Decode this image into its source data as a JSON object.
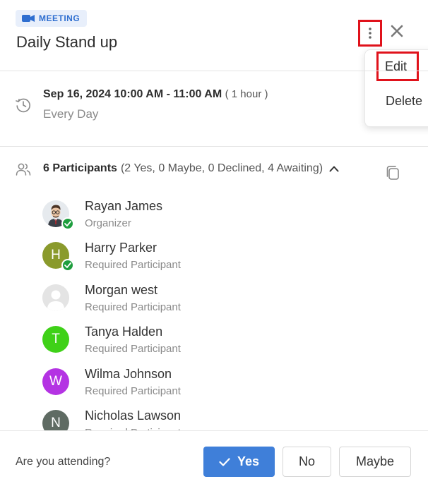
{
  "header": {
    "badge_label": "MEETING",
    "badge_icon": "video-camera-icon",
    "title": "Daily Stand up",
    "more_icon": "more-vertical-icon",
    "close_icon": "close-icon"
  },
  "menu": {
    "edit_label": "Edit",
    "delete_label": "Delete"
  },
  "schedule": {
    "datetime": "Sep 16, 2024 10:00 AM - 11:00 AM",
    "duration": "( 1 hour )",
    "recurrence": "Every Day",
    "icon": "clock-history-icon"
  },
  "participants": {
    "count_label": "6 Participants",
    "summary": "(2 Yes, 0 Maybe, 0 Declined, 4 Awaiting)",
    "people_icon": "people-icon",
    "toggle_icon": "chevron-up-icon",
    "copy_icon": "copy-icon",
    "list": [
      {
        "name": "Rayan James",
        "role": "Organizer",
        "avatar": "photo",
        "accepted": true
      },
      {
        "name": "Harry Parker",
        "role": "Required Participant",
        "initial": "H",
        "color": "#8a9a2c",
        "accepted": true
      },
      {
        "name": "Morgan west",
        "role": "Required Participant",
        "avatar": "placeholder",
        "accepted": false
      },
      {
        "name": "Tanya Halden",
        "role": "Required Participant",
        "initial": "T",
        "color": "#3fd118",
        "accepted": false
      },
      {
        "name": "Wilma Johnson",
        "role": "Required Participant",
        "initial": "W",
        "color": "#b433e3",
        "accepted": false
      },
      {
        "name": "Nicholas Lawson",
        "role": "Required Participant",
        "initial": "N",
        "color": "#5f6b63",
        "accepted": false
      }
    ]
  },
  "footer": {
    "question": "Are you attending?",
    "yes_label": "Yes",
    "no_label": "No",
    "maybe_label": "Maybe"
  },
  "colors": {
    "accent": "#3f7fd9",
    "highlight": "#e0121b",
    "accepted_check": "#1e9e3e"
  }
}
